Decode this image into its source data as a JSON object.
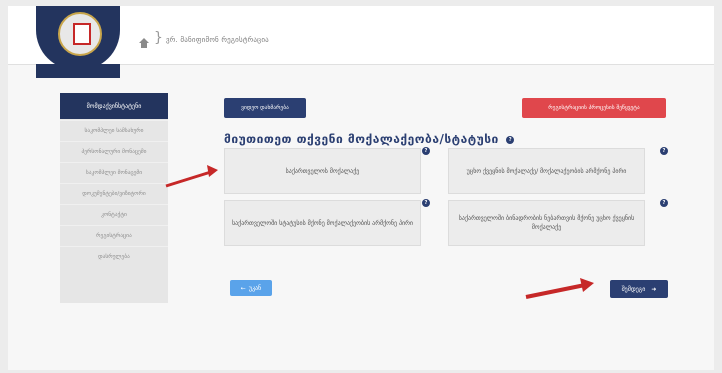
{
  "header": {
    "breadcrumb_text": "ვრ. მანიფიმონ რეგისტრაცია"
  },
  "sidebar": {
    "title": "მომდაქვინსტატენი",
    "items": [
      {
        "label": "საკომპლეი სამსახური"
      },
      {
        "label": "პერსონალური მონაცემი"
      },
      {
        "label": "საკომპლეი მონაცემი"
      },
      {
        "label": "დოკუმენტები/ვიზიტორი"
      },
      {
        "label": "კონტაქტი"
      },
      {
        "label": "რეგისტრაცია"
      },
      {
        "label": "დასრულება"
      }
    ]
  },
  "top_buttons": {
    "left_label": "ვიდეო დახმარება",
    "right_label": "რეგისტრაციის პროცესის შეწყვეტა"
  },
  "heading": "მიუთითეთ თქვენი მოქალაქეობა/სტატუსი",
  "options": [
    {
      "label": "საქართველოს მოქალაქე"
    },
    {
      "label": "უცხო ქვეყნის მოქალაქე/ მოქალაქეობის არმქონე პირი"
    },
    {
      "label": "საქართველოში სტატუსის მქონე მოქალაქეობის არმქონე პირი"
    },
    {
      "label": "საქართველოში ბინადრობის ნებართვის მქონე უცხო ქვეყნის მოქალაქე"
    }
  ],
  "nav": {
    "back_label": "უკან",
    "next_label": "შემდეგი"
  },
  "colors": {
    "primary": "#2b3f72",
    "danger": "#e0474c",
    "back": "#5aa3ea",
    "annotation_arrow": "#c62828"
  }
}
